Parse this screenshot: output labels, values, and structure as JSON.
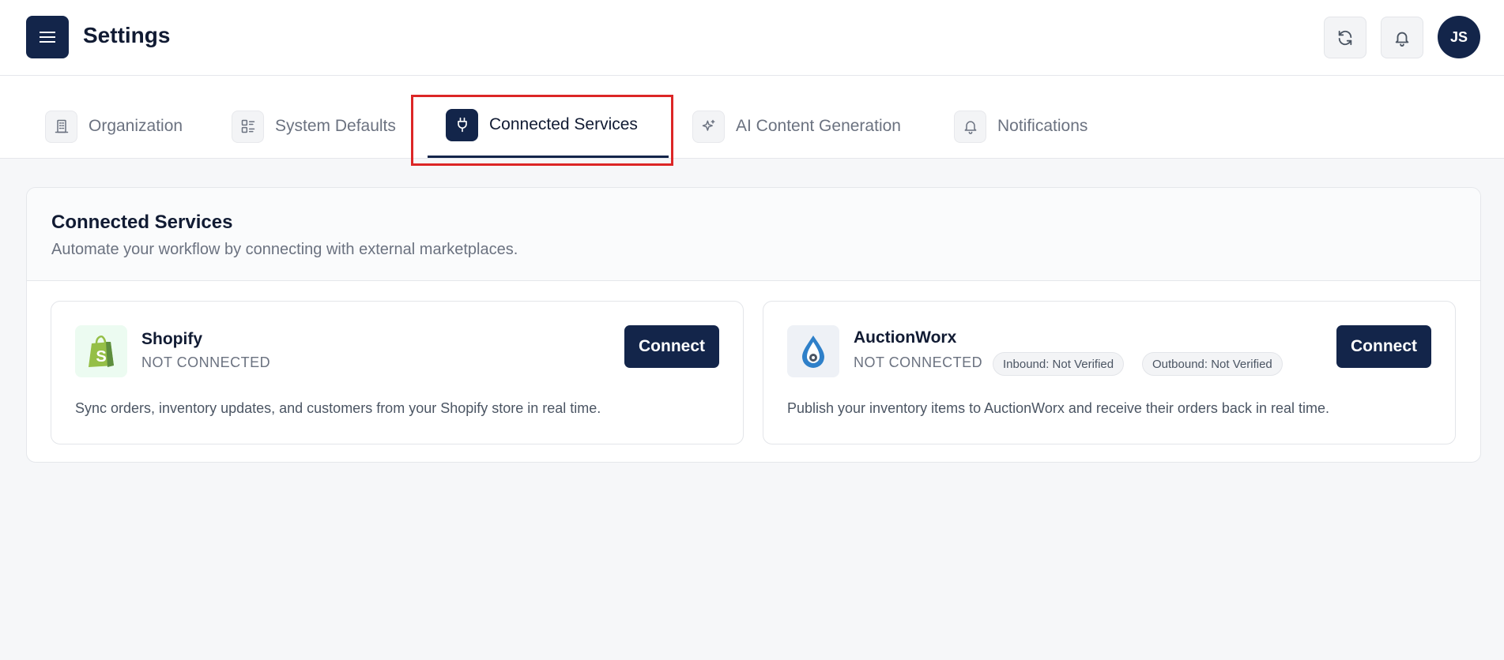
{
  "header": {
    "title": "Settings",
    "avatar_initials": "JS"
  },
  "tabs": [
    {
      "label": "Organization",
      "icon": "building-icon",
      "active": false
    },
    {
      "label": "System Defaults",
      "icon": "list-icon",
      "active": false
    },
    {
      "label": "Connected Services",
      "icon": "plug-icon",
      "active": true
    },
    {
      "label": "AI Content Generation",
      "icon": "sparkles-icon",
      "active": false
    },
    {
      "label": "Notifications",
      "icon": "bell-icon",
      "active": false
    }
  ],
  "panel": {
    "title": "Connected Services",
    "subtitle": "Automate your workflow by connecting with external marketplaces."
  },
  "services": [
    {
      "name": "Shopify",
      "status": "NOT CONNECTED",
      "button_label": "Connect",
      "description": "Sync orders, inventory updates, and customers from your Shopify store in real time."
    },
    {
      "name": "AuctionWorx",
      "status": "NOT CONNECTED",
      "badges": [
        "Inbound: Not Verified",
        "Outbound: Not Verified"
      ],
      "button_label": "Connect",
      "description": "Publish your inventory items to AuctionWorx and receive their orders back in real time."
    }
  ],
  "colors": {
    "primary": "#13254a",
    "highlight": "#dc2626",
    "muted_text": "#6b7280"
  }
}
